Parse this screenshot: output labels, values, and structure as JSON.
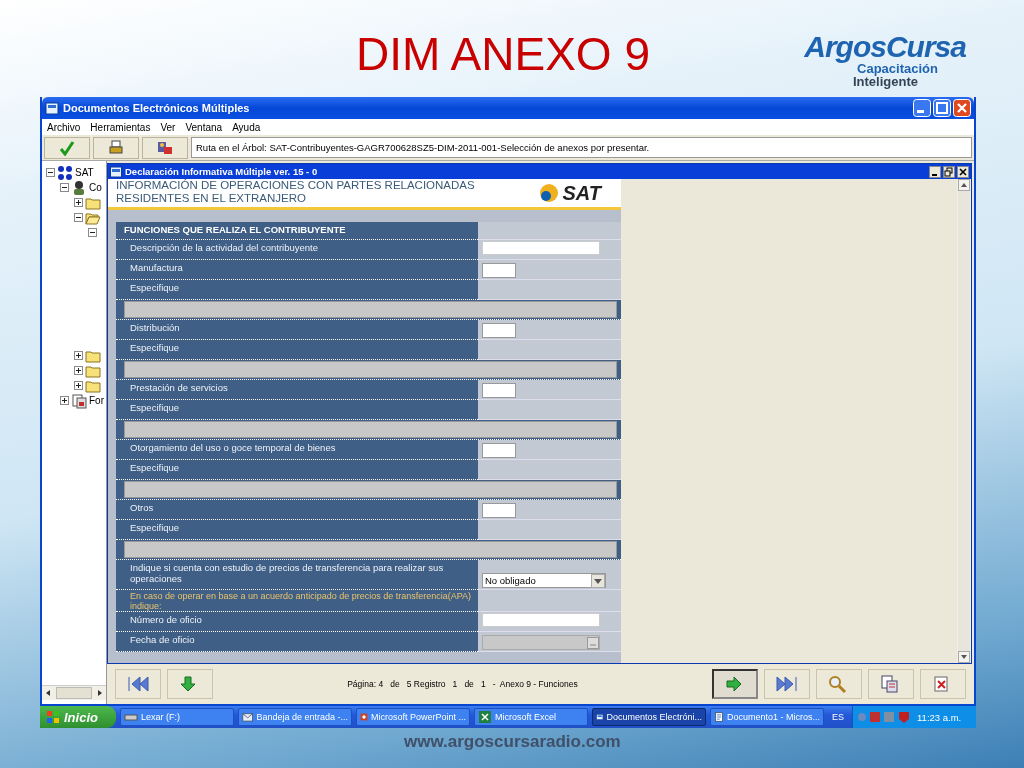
{
  "slide": {
    "title": "DIM ANEXO 9",
    "logo": {
      "brand": "ArgosCursa",
      "line_1": "Capacitación",
      "line_2": "Inteligente"
    },
    "footer": "www.argoscursaradio.com"
  },
  "window": {
    "title": "Documentos Electrónicos Múltiples",
    "menu": [
      "Archivo",
      "Herramientas",
      "Ver",
      "Ventana",
      "Ayuda"
    ],
    "toolbar": [
      {
        "kind": "check"
      },
      {
        "kind": "printer"
      },
      {
        "kind": "tools"
      }
    ],
    "path": "Ruta en el Árbol: SAT-Contribuyentes-GAGR700628SZ5-DIM-2011-001-Selección de anexos por presentar.",
    "tree": [
      {
        "label": "SAT",
        "kind": "network",
        "expanded": true,
        "children": [
          {
            "label": "Co",
            "kind": "person",
            "expanded": true,
            "children": [
              {
                "kind": "folder",
                "expanded": false
              },
              {
                "kind": "folder-open",
                "expanded": true,
                "children": [
                  {
                    "expanded": true
                  }
                ]
              },
              {
                "kind": "folder",
                "expanded": false
              },
              {
                "kind": "folder",
                "expanded": false
              },
              {
                "kind": "folder",
                "expanded": false
              }
            ]
          },
          {
            "label": "For",
            "kind": "document",
            "expanded": false
          }
        ]
      }
    ],
    "inner": {
      "title": "Declaración Informativa Múltiple ver. 15 - 0",
      "header": [
        "INFORMACIÓN DE OPERACIONES CON PARTES RELACIONADAS",
        "RESIDENTES EN EL EXTRANJERO"
      ],
      "logo": "SAT",
      "rows": [
        {
          "kind": "heading",
          "label": "FUNCIONES QUE REALIZA EL CONTRIBUYENTE"
        },
        {
          "kind": "wide",
          "label": "Descripción de la actividad del contribuyente"
        },
        {
          "kind": "small",
          "label": "Manufactura"
        },
        {
          "kind": "plain",
          "label": "Especifique"
        },
        {
          "kind": "textarea"
        },
        {
          "kind": "small",
          "label": "Distribución"
        },
        {
          "kind": "plain",
          "label": "Especifique"
        },
        {
          "kind": "textarea"
        },
        {
          "kind": "small",
          "label": "Prestación de servicios"
        },
        {
          "kind": "plain",
          "label": "Especifique"
        },
        {
          "kind": "textarea"
        },
        {
          "kind": "small",
          "label": "Otorgamiento del uso o goce temporal de bienes"
        },
        {
          "kind": "plain",
          "label": "Especifique"
        },
        {
          "kind": "textarea"
        },
        {
          "kind": "small",
          "label": "Otros"
        },
        {
          "kind": "plain",
          "label": "Especifique"
        },
        {
          "kind": "textarea"
        },
        {
          "kind": "select",
          "label": "Indique si cuenta con estudio de precios de transferencia para realizar sus operaciones",
          "value": "No obligado"
        },
        {
          "kind": "note",
          "label": "En caso de operar en base a un acuerdo anticipado de precios de transferencia(APA) indique:"
        },
        {
          "kind": "wide",
          "label": "Número de oficio"
        },
        {
          "kind": "date",
          "label": "Fecha de oficio"
        }
      ]
    },
    "nav": {
      "buttons_left": [
        {
          "kind": "first",
          "pressed": false
        },
        {
          "kind": "down",
          "pressed": false
        }
      ],
      "status": "Página: 4   de   5 Registro   1   de   1   -  Anexo 9 - Funciones",
      "buttons_right": [
        {
          "kind": "next",
          "pressed": true
        },
        {
          "kind": "last",
          "pressed": false
        },
        {
          "kind": "search",
          "pressed": false
        },
        {
          "kind": "view",
          "pressed": false
        },
        {
          "kind": "close",
          "pressed": false
        }
      ]
    }
  },
  "taskbar": {
    "start": "Inicio",
    "tasks": [
      {
        "label": "Lexar (F:)",
        "kind": "drive",
        "selected": false
      },
      {
        "label": "Bandeja de entrada -...",
        "kind": "mail",
        "selected": false
      },
      {
        "label": "Microsoft PowerPoint ...",
        "kind": "slides",
        "selected": false
      },
      {
        "label": "Microsoft Excel",
        "kind": "sheet",
        "selected": false
      },
      {
        "label": "Documentos Electróni...",
        "kind": "app",
        "selected": true
      },
      {
        "label": "Documento1 - Micros...",
        "kind": "doc",
        "selected": false
      }
    ],
    "language": "ES",
    "time": "11:23 a.m."
  }
}
